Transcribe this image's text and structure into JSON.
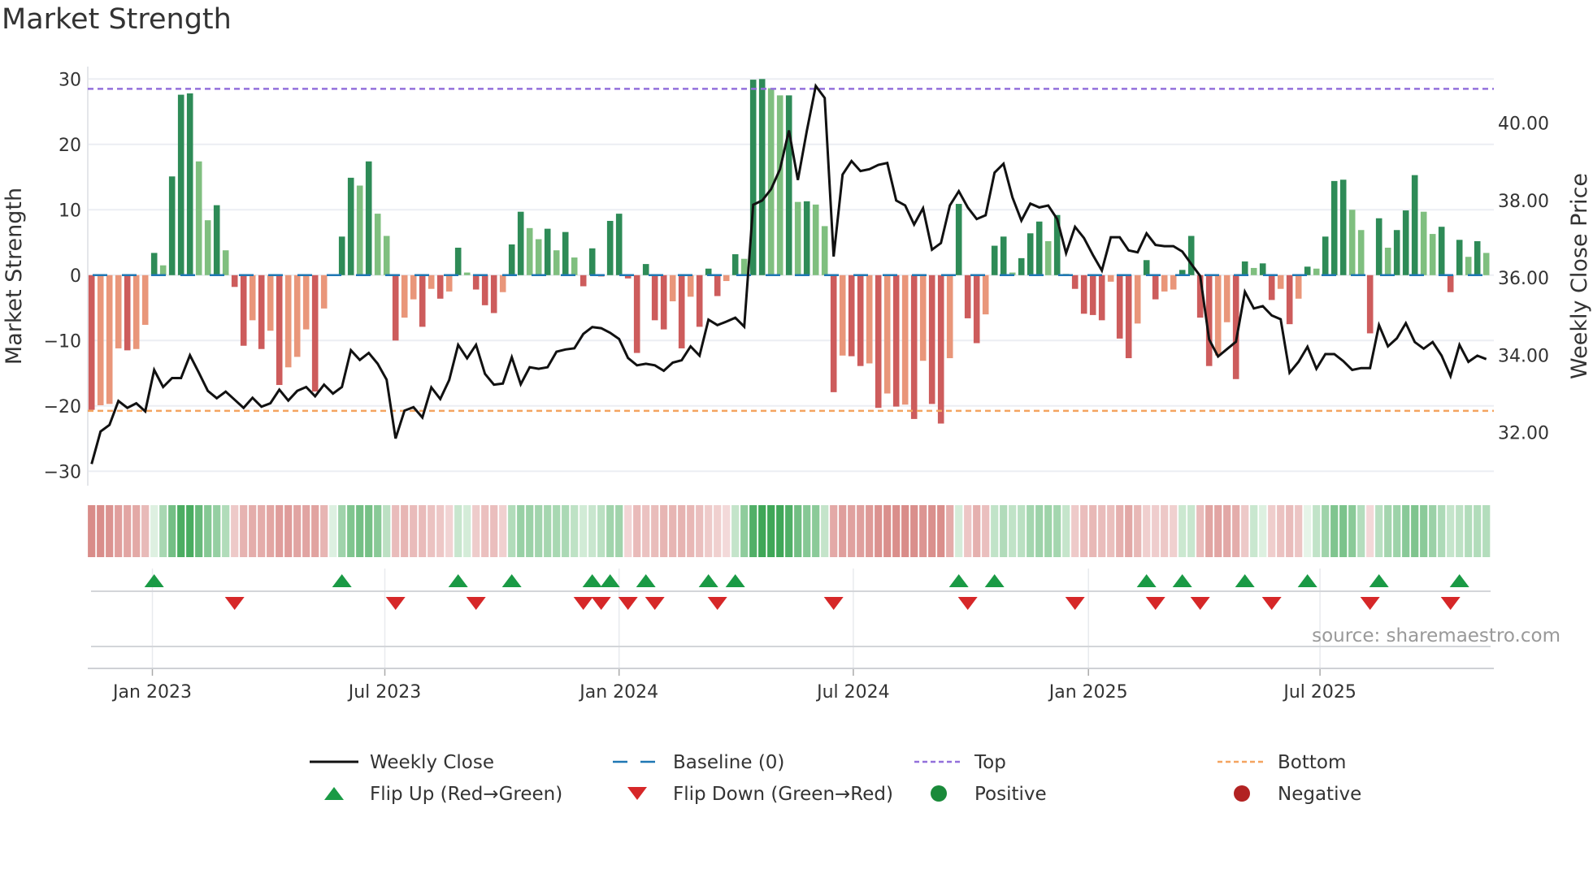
{
  "chart_data": {
    "type": "bar",
    "title": "Market Strength",
    "ylabel": "Market Strength",
    "y2label": "Weekly Close Price",
    "ylim": [
      -32.2,
      31.9
    ],
    "y2lim": [
      30.63,
      41.46
    ],
    "grid": true,
    "legend_position": "bottom",
    "x_unit": "week index",
    "x_ticks": [
      {
        "x": 6.8,
        "label": "Jan 2023"
      },
      {
        "x": 32.8,
        "label": "Jul 2023"
      },
      {
        "x": 59.0,
        "label": "Jan 2024"
      },
      {
        "x": 85.2,
        "label": "Jul 2024"
      },
      {
        "x": 111.5,
        "label": "Jan 2025"
      },
      {
        "x": 137.4,
        "label": "Jul 2025"
      }
    ],
    "y_ticks": [
      {
        "v": 30,
        "label": "30"
      },
      {
        "v": 20,
        "label": "20"
      },
      {
        "v": 10,
        "label": "10"
      },
      {
        "v": 0,
        "label": "0"
      },
      {
        "v": -10,
        "label": "−10"
      },
      {
        "v": -20,
        "label": "−20"
      },
      {
        "v": -30,
        "label": "−30"
      }
    ],
    "y2_ticks": [
      {
        "v": 40,
        "label": "40.00"
      },
      {
        "v": 38,
        "label": "38.00"
      },
      {
        "v": 36,
        "label": "36.00"
      },
      {
        "v": 34,
        "label": "34.00"
      },
      {
        "v": 32,
        "label": "32.00"
      }
    ],
    "top_level": 28.5,
    "bottom_level": -20.75,
    "baseline": 0,
    "strength": [
      -20.6,
      -19.9,
      -19.7,
      -11.2,
      -11.5,
      -11.3,
      -7.6,
      3.4,
      1.5,
      15.1,
      27.6,
      27.8,
      17.4,
      8.4,
      10.7,
      3.8,
      -1.8,
      -10.8,
      -6.9,
      -11.3,
      -8.5,
      -16.8,
      -14.1,
      -12.5,
      -8.3,
      -17.8,
      -5.1,
      0,
      5.9,
      14.9,
      13.7,
      17.4,
      9.4,
      6.0,
      -10.0,
      -6.5,
      -3.7,
      -7.9,
      -2.1,
      -3.6,
      -2.5,
      4.2,
      0.4,
      -2.2,
      -4.6,
      -5.8,
      -2.6,
      4.7,
      9.7,
      7.2,
      5.5,
      7.1,
      3.8,
      6.6,
      2.7,
      -1.7,
      4.1,
      -0.2,
      8.3,
      9.4,
      -0.5,
      -11.9,
      1.7,
      -6.9,
      -8.3,
      -4.0,
      -11.2,
      -3.3,
      -7.9,
      1.0,
      -3.2,
      -0.9,
      3.2,
      2.5,
      29.9,
      30.0,
      28.6,
      27.5,
      27.5,
      11.2,
      11.3,
      10.8,
      7.5,
      -17.9,
      -12.3,
      -12.4,
      -13.9,
      -13.5,
      -20.3,
      -18.1,
      -20.1,
      -19.8,
      -22.0,
      -13.1,
      -19.7,
      -22.7,
      -12.7,
      10.9,
      -6.6,
      -10.4,
      -6.0,
      4.5,
      5.9,
      0.4,
      2.6,
      6.4,
      8.2,
      5.2,
      9.2,
      0.2,
      -2.1,
      -5.9,
      -6.1,
      -6.9,
      -1.0,
      -9.7,
      -12.7,
      -7.4,
      2.3,
      -3.7,
      -2.5,
      -2.2,
      0.8,
      6.0,
      -6.5,
      -13.9,
      -12.3,
      -7.2,
      -15.9,
      2.1,
      1.1,
      1.8,
      -3.8,
      -2.1,
      -7.5,
      -3.6,
      1.3,
      1.0,
      5.9,
      14.4,
      14.6,
      10.0,
      6.9,
      -8.9,
      8.7,
      4.2,
      6.9,
      9.9,
      15.3,
      9.7,
      6.3,
      7.4,
      -2.6,
      5.4,
      2.8,
      5.2,
      3.4
    ],
    "close": [
      31.19,
      32.03,
      32.2,
      32.82,
      32.64,
      32.76,
      32.55,
      33.62,
      33.18,
      33.41,
      33.41,
      34.0,
      33.55,
      33.08,
      32.89,
      33.06,
      32.85,
      32.64,
      32.9,
      32.67,
      32.76,
      33.11,
      32.83,
      33.08,
      33.18,
      32.94,
      33.24,
      33.01,
      33.18,
      34.13,
      33.88,
      34.06,
      33.78,
      33.37,
      31.85,
      32.57,
      32.66,
      32.39,
      33.17,
      32.87,
      33.36,
      34.27,
      33.92,
      34.27,
      33.52,
      33.24,
      33.27,
      33.95,
      33.25,
      33.69,
      33.65,
      33.69,
      34.09,
      34.15,
      34.18,
      34.55,
      34.73,
      34.7,
      34.58,
      34.42,
      33.93,
      33.74,
      33.78,
      33.74,
      33.6,
      33.81,
      33.87,
      34.23,
      33.99,
      34.92,
      34.78,
      34.87,
      34.97,
      34.74,
      37.89,
      38.0,
      38.29,
      38.81,
      39.81,
      38.53,
      39.8,
      40.96,
      40.65,
      36.55,
      38.67,
      39.02,
      38.76,
      38.81,
      38.92,
      38.97,
      38.0,
      37.87,
      37.38,
      37.8,
      36.73,
      36.9,
      37.87,
      38.24,
      37.82,
      37.52,
      37.62,
      38.72,
      38.95,
      38.08,
      37.48,
      37.92,
      37.82,
      37.87,
      37.52,
      36.64,
      37.32,
      37.03,
      36.59,
      36.19,
      37.05,
      37.05,
      36.71,
      36.66,
      37.15,
      36.85,
      36.82,
      36.82,
      36.68,
      36.36,
      36.05,
      34.41,
      33.97,
      34.16,
      34.35,
      35.64,
      35.21,
      35.27,
      35.03,
      34.93,
      33.55,
      33.83,
      34.22,
      33.65,
      34.03,
      34.03,
      33.85,
      33.62,
      33.67,
      33.67,
      34.78,
      34.23,
      34.44,
      34.83,
      34.34,
      34.17,
      34.34,
      33.99,
      33.46,
      34.27,
      33.83,
      33.99,
      33.9
    ],
    "flip_up_weeks": [
      7,
      28,
      41,
      47,
      56,
      58,
      62,
      69,
      72,
      97,
      101,
      118,
      122,
      129,
      136,
      144,
      153
    ],
    "flip_down_weeks": [
      16,
      34,
      43,
      55,
      57,
      60,
      63,
      70,
      83,
      98,
      110,
      119,
      124,
      132,
      143,
      152
    ],
    "legend": [
      {
        "key": "close",
        "label": "Weekly Close"
      },
      {
        "key": "baseline",
        "label": "Baseline (0)"
      },
      {
        "key": "top",
        "label": "Top"
      },
      {
        "key": "bottom",
        "label": "Bottom"
      },
      {
        "key": "flip_up",
        "label": "Flip Up (Red→Green)"
      },
      {
        "key": "flip_down",
        "label": "Flip Down (Green→Red)"
      },
      {
        "key": "positive",
        "label": "Positive"
      },
      {
        "key": "negative",
        "label": "Negative"
      }
    ],
    "colors": {
      "pos_strong": "#2e8b57",
      "pos_weak": "#7fbf7f",
      "neg_strong": "#cd5c5c",
      "neg_weak": "#e9967a",
      "close": "#111111",
      "baseline": "#1f77b4",
      "top": "#9370db",
      "bottom": "#f4a460",
      "flip_up": "#1a9a45",
      "flip_down": "#d62728",
      "positive": "#1a8a3a",
      "negative": "#b22222"
    }
  },
  "source": "source: sharemaestro.com"
}
